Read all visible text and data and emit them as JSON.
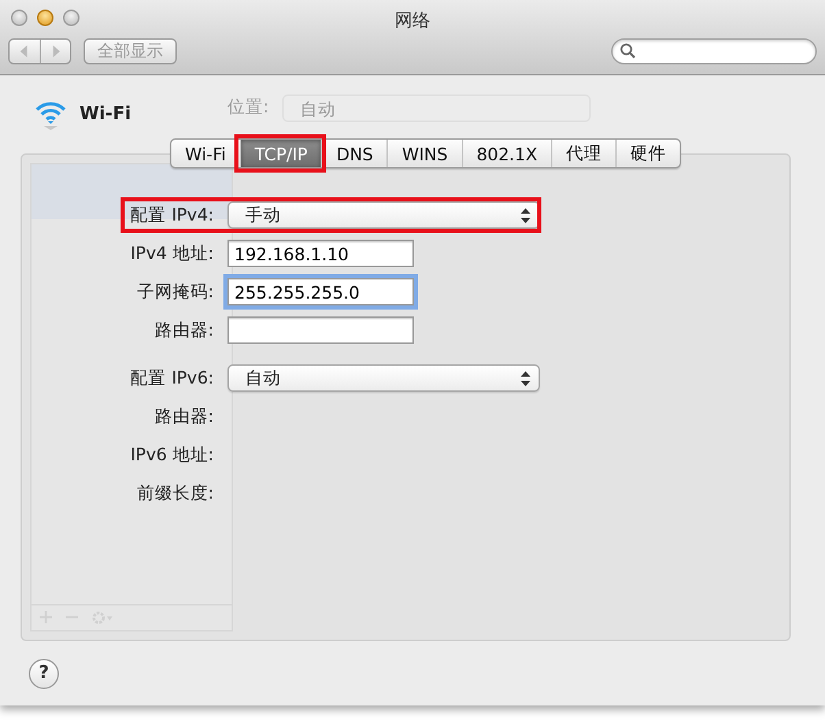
{
  "window": {
    "title": "网络"
  },
  "toolbar": {
    "show_all_button": "全部显示"
  },
  "header": {
    "service": "Wi-Fi",
    "location_label": "位置:",
    "location_value": "自动"
  },
  "tabs": [
    {
      "label": "Wi-Fi",
      "selected": false,
      "highlighted": false
    },
    {
      "label": "TCP/IP",
      "selected": true,
      "highlighted": true
    },
    {
      "label": "DNS",
      "selected": false,
      "highlighted": false
    },
    {
      "label": "WINS",
      "selected": false,
      "highlighted": false
    },
    {
      "label": "802.1X",
      "selected": false,
      "highlighted": false
    },
    {
      "label": "代理",
      "selected": false,
      "highlighted": false
    },
    {
      "label": "硬件",
      "selected": false,
      "highlighted": false
    }
  ],
  "ipv4": {
    "config": {
      "label": "配置 IPv4:",
      "value": "手动",
      "highlighted": true
    },
    "fields": [
      {
        "label": "IPv4 地址:",
        "value": "192.168.1.10",
        "focused": false
      },
      {
        "label": "子网掩码:",
        "value": "255.255.255.0",
        "focused": true
      },
      {
        "label": "路由器:",
        "focused": false
      }
    ]
  },
  "ipv6": {
    "config": {
      "label": "配置 IPv6:",
      "value": "自动"
    },
    "rows": [
      {
        "label": "路由器:"
      },
      {
        "label": "IPv6 地址:"
      },
      {
        "label": "前缀长度:"
      }
    ]
  },
  "help_button": "?"
}
